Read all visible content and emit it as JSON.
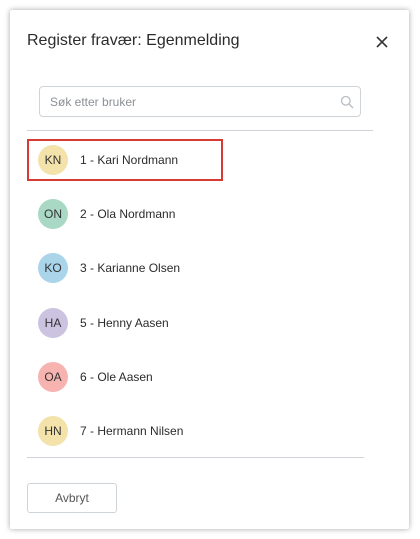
{
  "dialog": {
    "title": "Register fravær: Egenmelding",
    "close_icon": "close-icon"
  },
  "search": {
    "placeholder": "Søk etter bruker",
    "value": "",
    "icon": "search-icon"
  },
  "users": [
    {
      "initials": "KN",
      "label": "1 - Kari Nordmann",
      "color": "#f3e2a9",
      "selected": true
    },
    {
      "initials": "ON",
      "label": "2 - Ola Nordmann",
      "color": "#a9d8c4",
      "selected": false
    },
    {
      "initials": "KO",
      "label": "3 - Karianne Olsen",
      "color": "#a9d4ea",
      "selected": false
    },
    {
      "initials": "HA",
      "label": "5 - Henny Aasen",
      "color": "#cbc3e0",
      "selected": false
    },
    {
      "initials": "OA",
      "label": "6 - Ole Aasen",
      "color": "#f6b3b0",
      "selected": false
    },
    {
      "initials": "HN",
      "label": "7 - Hermann Nilsen",
      "color": "#f3e2a9",
      "selected": false
    }
  ],
  "colors": {
    "selection_border": "#d83a34"
  },
  "footer": {
    "cancel_label": "Avbryt"
  }
}
